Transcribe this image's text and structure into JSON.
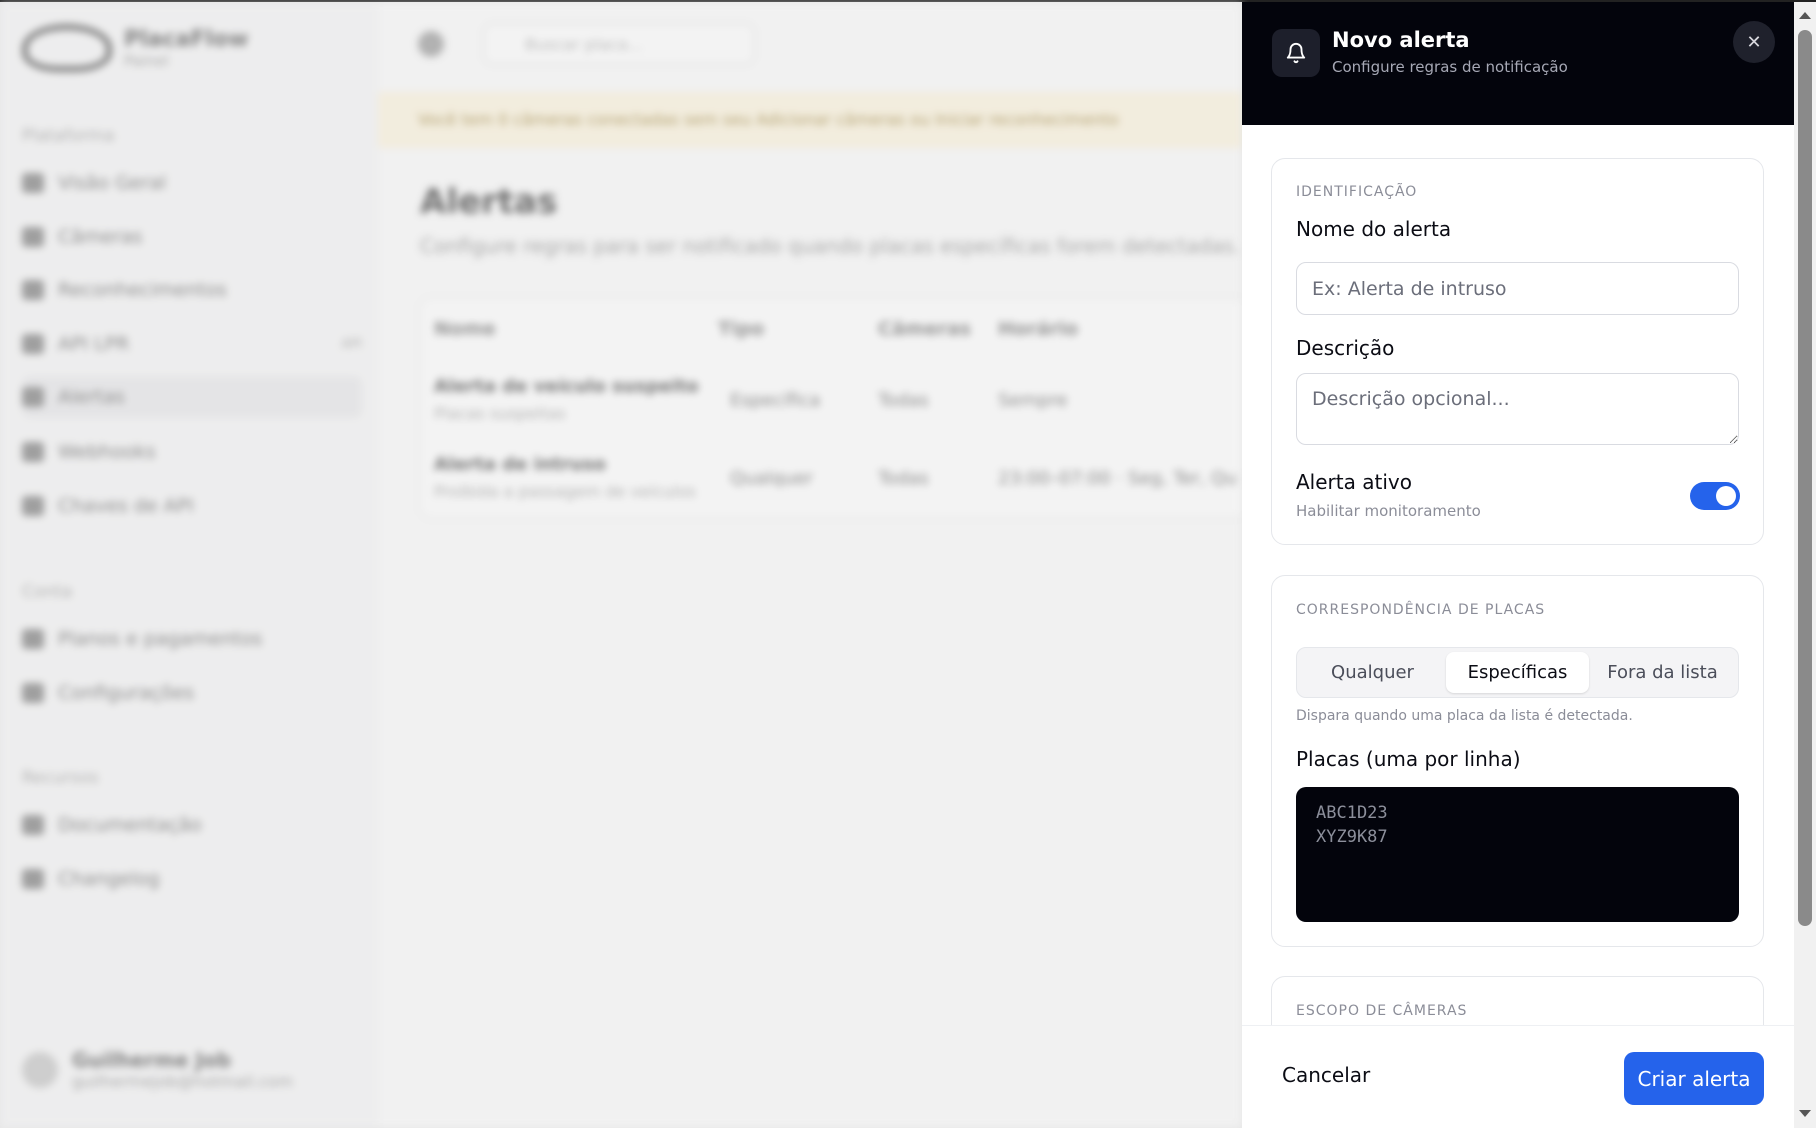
{
  "background": {
    "brand": {
      "name": "PlacaFlow",
      "sub": "Painel"
    },
    "sidebar": {
      "sections": [
        {
          "label": "Plataforma",
          "items": [
            {
              "label": "Visão Geral"
            },
            {
              "label": "Câmeras"
            },
            {
              "label": "Reconhecimentos"
            },
            {
              "label": "API LPR",
              "badge": "API"
            },
            {
              "label": "Alertas"
            },
            {
              "label": "Webhooks"
            },
            {
              "label": "Chaves de API"
            }
          ]
        },
        {
          "label": "Conta",
          "items": [
            {
              "label": "Planos e pagamentos"
            },
            {
              "label": "Configurações"
            }
          ]
        },
        {
          "label": "Recursos",
          "items": [
            {
              "label": "Documentação"
            },
            {
              "label": "Changelog"
            }
          ]
        }
      ],
      "user": {
        "name": "Guilherme Job",
        "email": "guilhermejob@hotmail.com"
      }
    },
    "main": {
      "search_placeholder": "Buscar placa...",
      "warning": "Você tem 0 câmeras conectadas sem seu  Adicionar câmeras ou  Iniciar reconhecimento",
      "title": "Alertas",
      "subtitle": "Configure regras para ser notificado quando placas específicas forem detectadas.",
      "table": {
        "headers": [
          "Nome",
          "Tipo",
          "Câmeras",
          "Horário"
        ],
        "rows": [
          {
            "name": "Alerta de veículo suspeito",
            "desc": "Placas suspeitas",
            "type": "Específica",
            "cameras": "Todas",
            "schedule": "Sempre"
          },
          {
            "name": "Alerta de intruso",
            "desc": "Proibida a passagem de veículos",
            "type": "Qualquer",
            "cameras": "Todas",
            "schedule": "23:00–07:00 · Seg, Ter, Qu"
          }
        ]
      }
    }
  },
  "panel": {
    "title": "Novo alerta",
    "subtitle": "Configure regras de notificação",
    "icons": {
      "header": "bell-icon",
      "close": "close-icon"
    },
    "identification": {
      "section_label": "IDENTIFICAÇÃO",
      "name_label": "Nome do alerta",
      "name_value": "",
      "name_placeholder": "Ex: Alerta de intruso",
      "description_label": "Descrição",
      "description_value": "",
      "description_placeholder": "Descrição opcional...",
      "active_label": "Alerta ativo",
      "active_hint": "Habilitar monitoramento",
      "active": true
    },
    "matching": {
      "section_label": "CORRESPONDÊNCIA DE PLACAS",
      "options": [
        "Qualquer",
        "Específicas",
        "Fora da lista"
      ],
      "selected": "Específicas",
      "hint": "Dispara quando uma placa da lista é detectada.",
      "plates_label": "Placas (uma por linha)",
      "plates_value": "",
      "plates_placeholder": "ABC1D23\nXYZ9K87"
    },
    "cameras": {
      "section_label": "ESCOPO DE CÂMERAS"
    },
    "footer": {
      "cancel_label": "Cancelar",
      "create_label": "Criar alerta"
    }
  },
  "colors": {
    "accent": "#2563eb",
    "header_bg": "#03040c",
    "plates_bg": "#03040c"
  }
}
